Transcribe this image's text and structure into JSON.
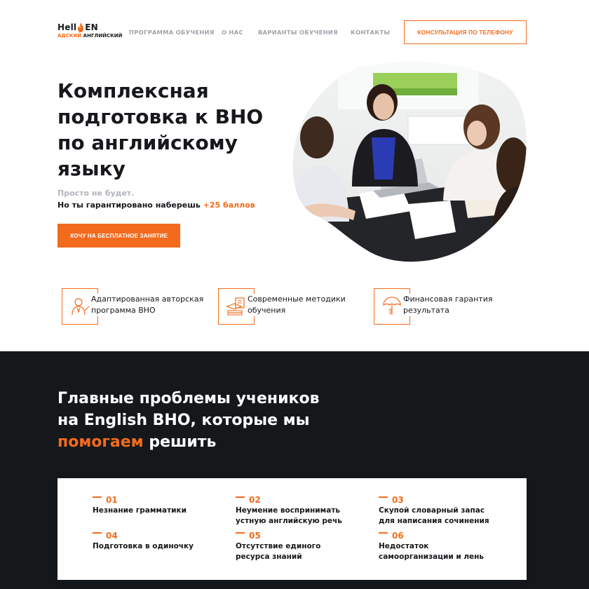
{
  "header": {
    "logo": {
      "top_left": "Hell",
      "top_right": "EN",
      "sub_orange": "АДСКИЙ",
      "sub_dark": "АНГЛИЙСКИЙ"
    },
    "nav": [
      {
        "label": "ПРОГРАММА ОБУЧЕНИЯ"
      },
      {
        "label": "О НАС"
      },
      {
        "label": "ВАРИАНТЫ ОБУЧЕНИЯ"
      },
      {
        "label": "КОНТАКТЫ"
      }
    ],
    "cta_label": "КОНСУЛЬТАЦИЯ ПО ТЕЛЕФОНУ"
  },
  "hero": {
    "title_lines": [
      "Комплексная",
      "подготовка к ВНО",
      "по английскому",
      "языку"
    ],
    "sub1": "Просто не будет.",
    "sub2_prefix": "Но ты гарантировано наберешь ",
    "sub2_accent": "+25 баллов",
    "button_label": "ХОЧУ НА БЕСПЛАТНОЕ ЗАНЯТИЕ"
  },
  "features": [
    {
      "line1": "Адаптированная авторская",
      "line2": "программа ВНО",
      "icon": "teacher-icon"
    },
    {
      "line1": "Современные методики",
      "line2": "обучения",
      "icon": "books-icon"
    },
    {
      "line1": "Финансовая гарантия",
      "line2": "результата",
      "icon": "money-umbrella-icon"
    }
  ],
  "problems_section": {
    "title_line1": "Главные проблемы учеников",
    "title_line2": "на English ВНО, которые мы",
    "title_accent": "помогаем",
    "title_end": " решить",
    "items": [
      {
        "num": "01",
        "line1": "Незнание грамматики",
        "line2": ""
      },
      {
        "num": "02",
        "line1": "Неумение воспринимать",
        "line2": "устную английскую речь"
      },
      {
        "num": "03",
        "line1": "Скупой словарный запас",
        "line2": "для написания сочинения"
      },
      {
        "num": "04",
        "line1": "Подготовка в одиночку",
        "line2": ""
      },
      {
        "num": "05",
        "line1": "Отсутствие единого",
        "line2": "ресурса знаний"
      },
      {
        "num": "06",
        "line1": "Недостаток",
        "line2": "самоорганизации и лень"
      }
    ]
  },
  "colors": {
    "accent": "#f26b1d",
    "dark": "#15181b",
    "muted": "#9ea3aa"
  }
}
